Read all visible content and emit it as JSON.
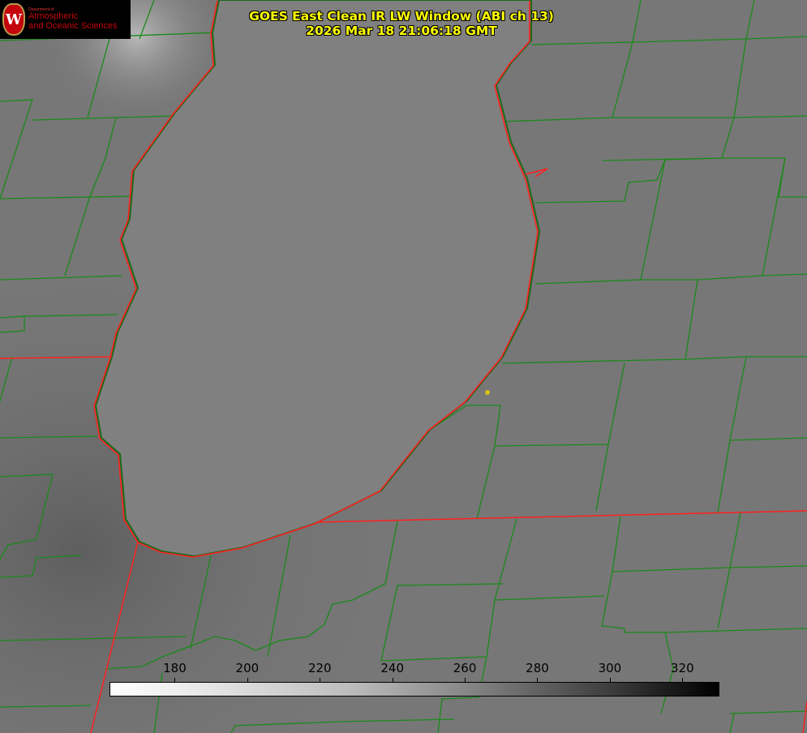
{
  "title": {
    "line1": "GOES East Clean IR LW Window (ABI ch 13)",
    "line2": "2026 Mar 18 21:06:18 GMT"
  },
  "logo": {
    "small": "Department of",
    "line1": "Atmospheric",
    "line2": "and Oceanic Sciences",
    "seal_letter": "W"
  },
  "colorbar": {
    "unit_range": [
      162,
      330
    ],
    "ticks": [
      "180",
      "200",
      "220",
      "240",
      "260",
      "280",
      "300",
      "320"
    ],
    "tick_values": [
      180,
      200,
      220,
      240,
      260,
      280,
      300,
      320
    ]
  },
  "colors": {
    "title": "#ffff00",
    "county_lines": "#1a8a1a",
    "state_lines": "#ff2020",
    "marker": "#d4c21a"
  }
}
